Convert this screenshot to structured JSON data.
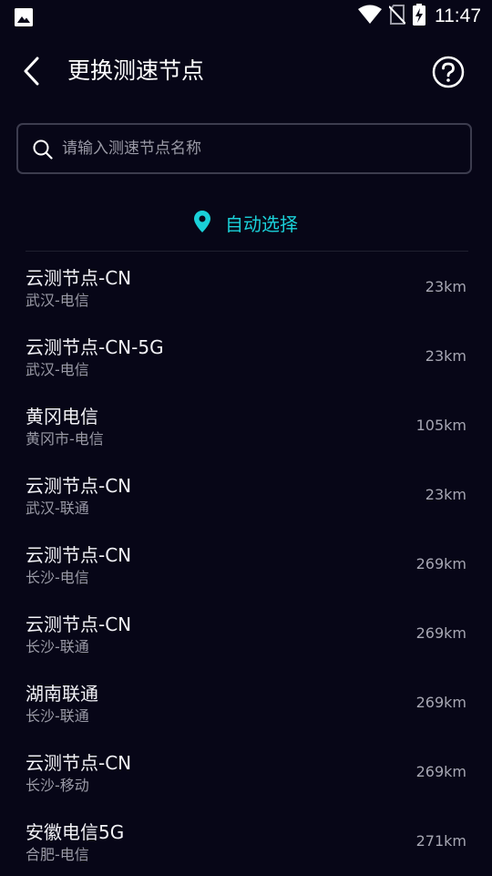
{
  "status_bar": {
    "time": "11:47",
    "icons": [
      "gallery-icon",
      "wifi-icon",
      "no-sim-icon",
      "battery-charging-icon"
    ]
  },
  "header": {
    "title": "更换测速节点",
    "back_icon": "back-arrow-icon",
    "help_icon": "help-circle-icon"
  },
  "search": {
    "placeholder": "请输入测速节点名称",
    "value": "",
    "icon": "search-icon"
  },
  "auto_select": {
    "label": "自动选择",
    "icon": "location-pin-icon",
    "color": "#1ad0d8"
  },
  "nodes": [
    {
      "name": "云测节点-CN",
      "location": "武汉-电信",
      "distance": "23km"
    },
    {
      "name": "云测节点-CN-5G",
      "location": "武汉-电信",
      "distance": "23km"
    },
    {
      "name": "黄冈电信",
      "location": "黄冈市-电信",
      "distance": "105km"
    },
    {
      "name": "云测节点-CN",
      "location": "武汉-联通",
      "distance": "23km"
    },
    {
      "name": "云测节点-CN",
      "location": "长沙-电信",
      "distance": "269km"
    },
    {
      "name": "云测节点-CN",
      "location": "长沙-联通",
      "distance": "269km"
    },
    {
      "name": "湖南联通",
      "location": "长沙-联通",
      "distance": "269km"
    },
    {
      "name": "云测节点-CN",
      "location": "长沙-移动",
      "distance": "269km"
    },
    {
      "name": "安徽电信5G",
      "location": "合肥-电信",
      "distance": "271km"
    }
  ],
  "colors": {
    "background": "#070617",
    "accent": "#1ad0d8"
  }
}
